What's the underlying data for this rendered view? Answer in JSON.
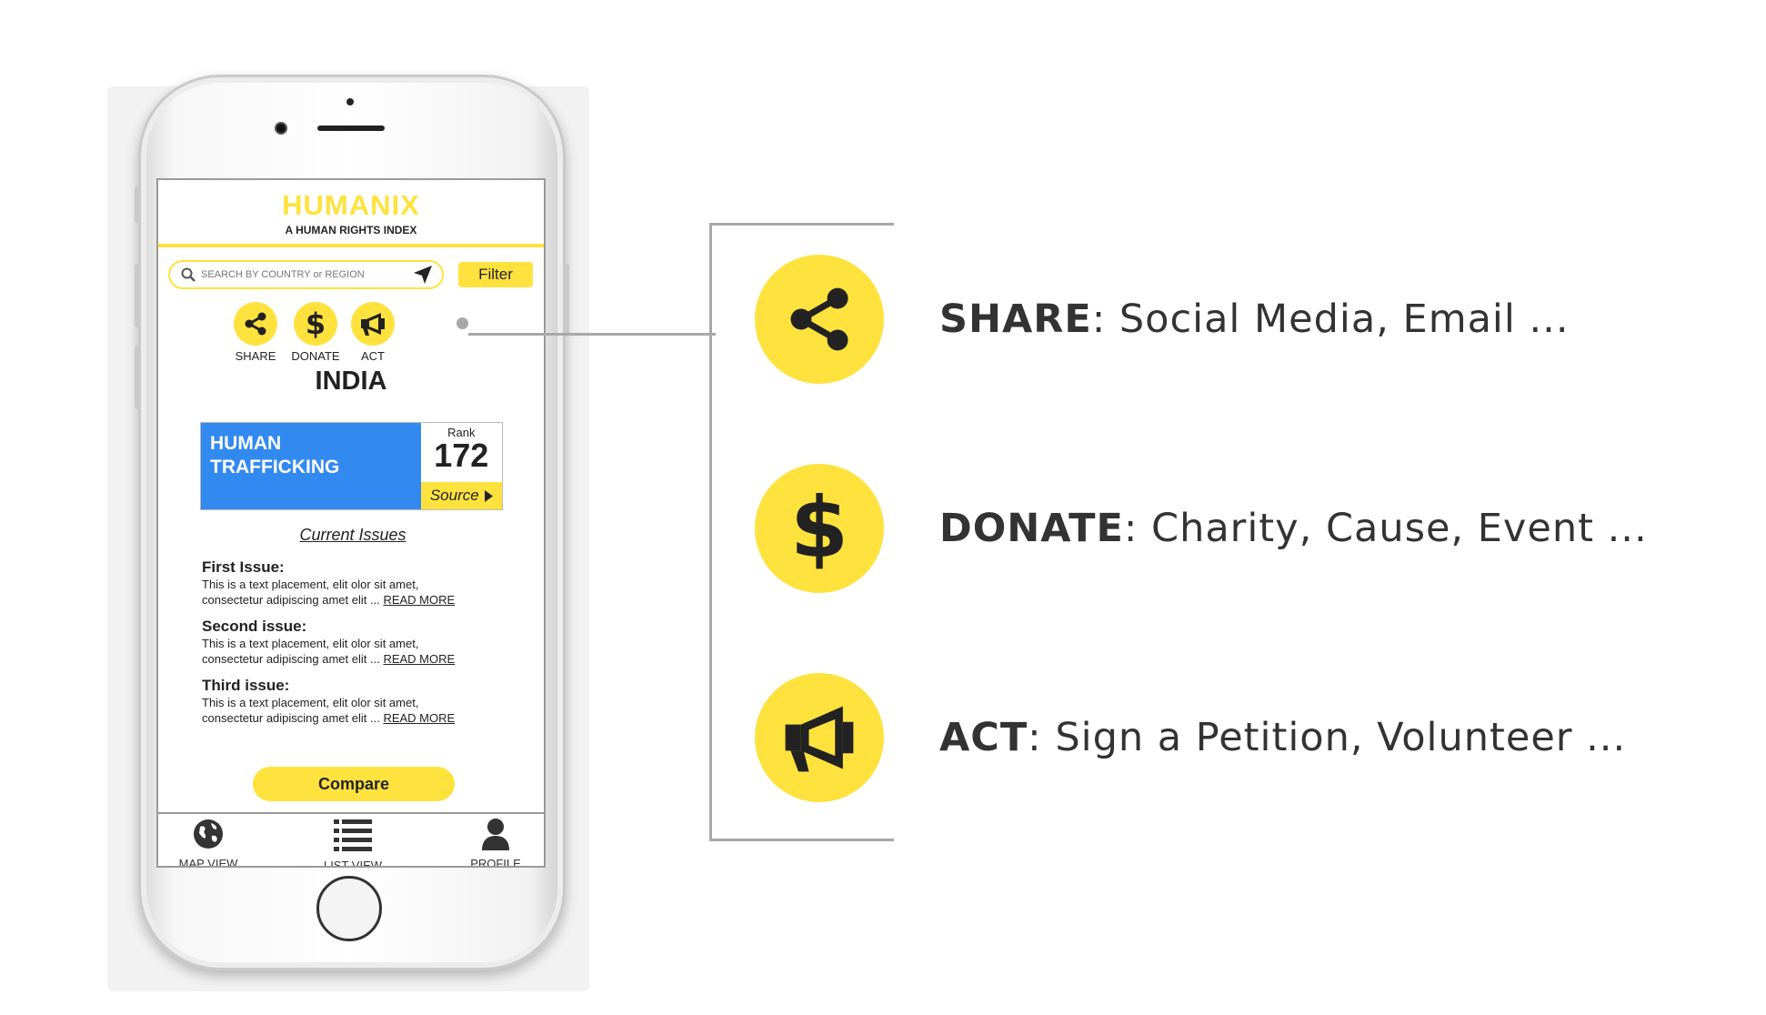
{
  "app": {
    "title": "HUMANIX",
    "subtitle": "A HUMAN RIGHTS INDEX"
  },
  "search": {
    "placeholder": "SEARCH BY COUNTRY or REGION",
    "filter_label": "Filter"
  },
  "actions": [
    {
      "label": "SHARE",
      "icon": "share-icon"
    },
    {
      "label": "DONATE",
      "icon": "dollar-icon"
    },
    {
      "label": "ACT",
      "icon": "megaphone-icon"
    }
  ],
  "country": "INDIA",
  "issue_card": {
    "title_line1": "HUMAN",
    "title_line2": "TRAFFICKING",
    "rank_label": "Rank",
    "rank_value": "172",
    "source_label": "Source"
  },
  "current_issues_label": "Current Issues",
  "issues": [
    {
      "title": "First Issue:",
      "line1": "This is a text placement, elit olor sit amet,",
      "line2": "consectetur adipiscing amet elit ...",
      "read_more": "READ MORE"
    },
    {
      "title": "Second issue:",
      "line1": "This is a text placement, elit olor sit amet,",
      "line2": "consectetur adipiscing amet elit ...",
      "read_more": "READ MORE"
    },
    {
      "title": "Third issue:",
      "line1": "This is a text placement, elit olor sit amet,",
      "line2": "consectetur adipiscing amet elit ...",
      "read_more": "READ MORE"
    }
  ],
  "compare_label": "Compare",
  "bottom_nav": [
    {
      "label": "MAP VIEW",
      "icon": "globe-icon"
    },
    {
      "label": "LIST VIEW",
      "icon": "list-icon"
    },
    {
      "label": "PROFILE",
      "icon": "person-icon"
    }
  ],
  "features": [
    {
      "name": "SHARE",
      "description": ": Social Media, Email ...",
      "icon": "share-icon"
    },
    {
      "name": "DONATE",
      "description": ": Charity, Cause, Event ...",
      "icon": "dollar-icon"
    },
    {
      "name": "ACT",
      "description": ": Sign a Petition, Volunteer ...",
      "icon": "megaphone-icon"
    }
  ],
  "colors": {
    "accent_yellow": "#ffe23d",
    "card_blue": "#3289f0",
    "text_dark": "#222222",
    "line_gray": "#a8a8a8"
  }
}
